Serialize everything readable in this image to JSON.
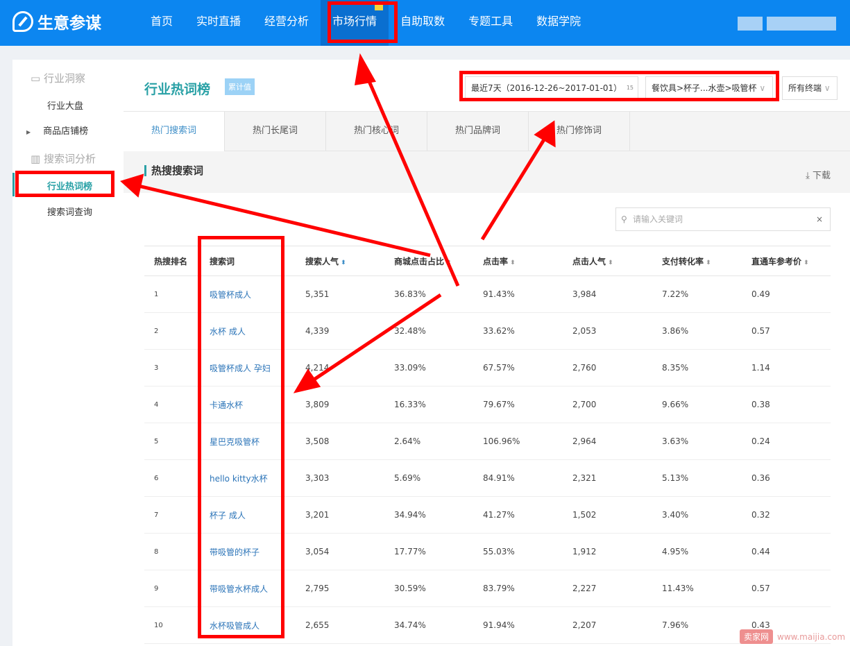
{
  "header": {
    "logo": "生意参谋",
    "nav": [
      "首页",
      "实时直播",
      "经营分析",
      "市场行情",
      "自助取数",
      "专题工具",
      "数据学院"
    ],
    "active": "市场行情"
  },
  "sidebar": {
    "groups": [
      {
        "label": "行业洞察",
        "icon": "monitor-chart-icon",
        "items": [
          "行业大盘",
          "商品店铺榜"
        ]
      },
      {
        "label": "搜索词分析",
        "icon": "bar-chart-icon",
        "items": [
          "行业热词榜",
          "搜索词查询"
        ]
      }
    ],
    "active": "行业热词榜"
  },
  "main": {
    "title": "行业热词榜",
    "tag": "累计值",
    "date_filter": "最近7天（2016-12-26~2017-01-01）",
    "calendar_day": "15",
    "category_filter": "餐饮具>杯子...水壶>吸管杯",
    "terminal_filter": "所有终端",
    "tabs": [
      "热门搜索词",
      "热门长尾词",
      "热门核心词",
      "热门品牌词",
      "热门修饰词"
    ],
    "active_tab": "热门搜索词",
    "section_title": "热搜搜索词",
    "download": "下载",
    "search_placeholder": "请输入关键词",
    "columns": [
      "热搜排名",
      "搜索词",
      "搜索人气",
      "商城点击占比",
      "点击率",
      "点击人气",
      "支付转化率",
      "直通车参考价"
    ],
    "rows": [
      [
        "1",
        "吸管杯成人",
        "5,351",
        "36.83%",
        "91.43%",
        "3,984",
        "7.22%",
        "0.49"
      ],
      [
        "2",
        "水杯 成人",
        "4,339",
        "32.48%",
        "33.62%",
        "2,053",
        "3.86%",
        "0.57"
      ],
      [
        "3",
        "吸管杯成人 孕妇",
        "4,214",
        "33.09%",
        "67.57%",
        "2,760",
        "8.35%",
        "1.14"
      ],
      [
        "4",
        "卡通水杯",
        "3,809",
        "16.33%",
        "79.67%",
        "2,700",
        "9.66%",
        "0.38"
      ],
      [
        "5",
        "星巴克吸管杯",
        "3,508",
        "2.64%",
        "106.96%",
        "2,964",
        "3.63%",
        "0.24"
      ],
      [
        "6",
        "hello kitty水杯",
        "3,303",
        "5.69%",
        "84.91%",
        "2,321",
        "5.13%",
        "0.36"
      ],
      [
        "7",
        "杯子 成人",
        "3,201",
        "34.94%",
        "41.27%",
        "1,502",
        "3.40%",
        "0.32"
      ],
      [
        "8",
        "带吸管的杯子",
        "3,054",
        "17.77%",
        "55.03%",
        "1,912",
        "4.95%",
        "0.44"
      ],
      [
        "9",
        "带吸管水杯成人",
        "2,795",
        "30.59%",
        "83.79%",
        "2,227",
        "11.43%",
        "0.57"
      ],
      [
        "10",
        "水杯吸管成人",
        "2,655",
        "34.74%",
        "91.94%",
        "2,207",
        "7.96%",
        "0.43"
      ]
    ]
  },
  "watermark": {
    "brand": "卖家网",
    "url": "www.maijia.com"
  },
  "colors": {
    "header": "#0c86f0",
    "accent": "#2aa1a6",
    "link": "#2b74b8",
    "annotation": "#ff0000"
  }
}
